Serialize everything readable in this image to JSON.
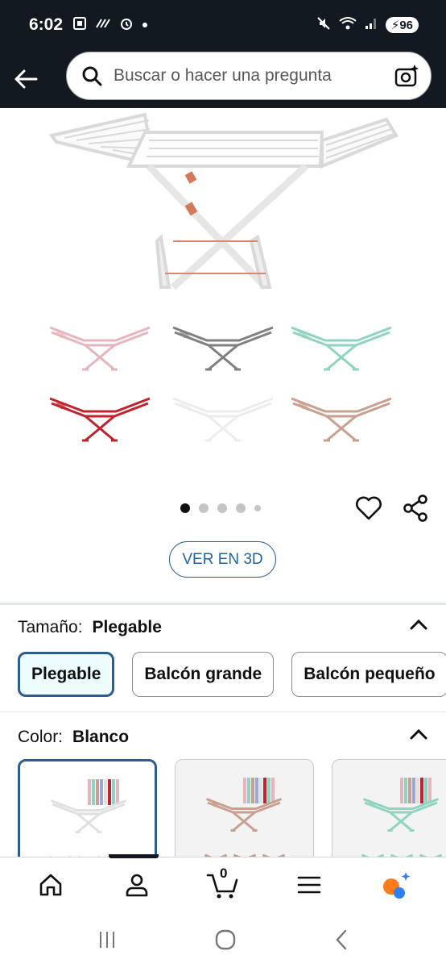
{
  "status": {
    "time": "6:02",
    "battery": "96"
  },
  "search": {
    "placeholder": "Buscar o hacer una pregunta"
  },
  "gallery": {
    "view_3d_label": "VER EN 3D",
    "dot_count": 5,
    "active_dot": 0,
    "variant_colors": [
      "#e8b4bc",
      "#808080",
      "#8fd4c0",
      "#c0232b",
      "#ececec",
      "#c9a08f"
    ]
  },
  "size": {
    "label": "Tamaño:",
    "value": "Plegable",
    "options": [
      "Plegable",
      "Balcón grande",
      "Balcón pequeño"
    ]
  },
  "color": {
    "label": "Color:",
    "value": "Blanco"
  },
  "cart": {
    "count": "0"
  },
  "colors": {
    "header_bg": "#131921",
    "selected_border": "#2e5d8c",
    "link": "#2162a1"
  }
}
